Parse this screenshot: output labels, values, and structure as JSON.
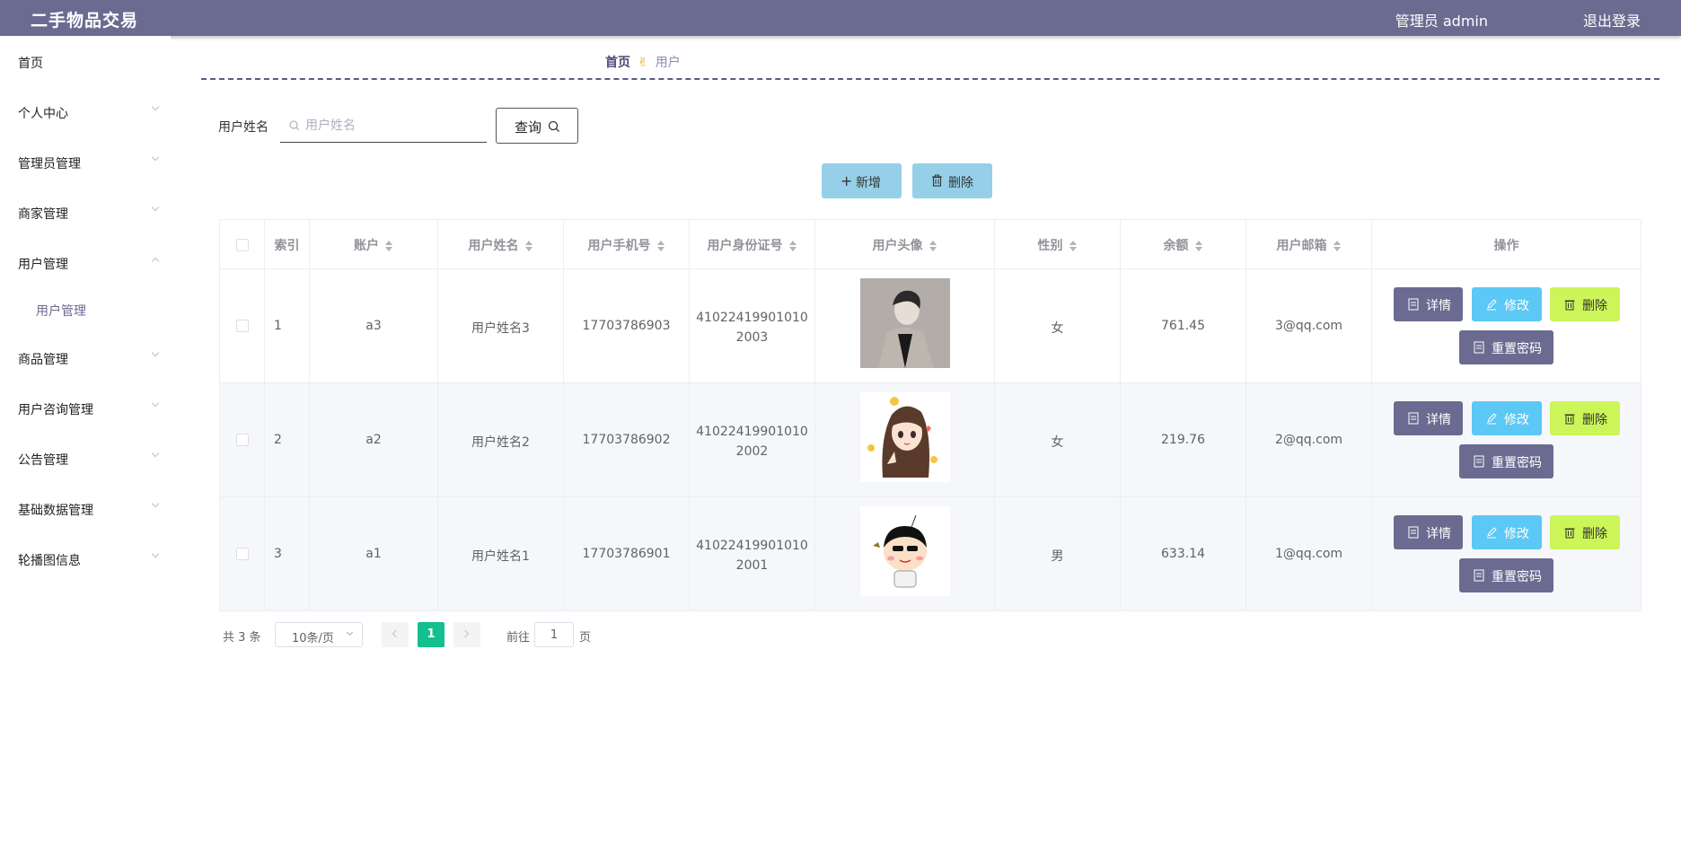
{
  "header": {
    "app_title": "二手物品交易",
    "admin_label": "管理员 admin",
    "logout": "退出登录"
  },
  "sidebar": {
    "items": [
      {
        "label": "首页"
      },
      {
        "label": "个人中心"
      },
      {
        "label": "管理员管理"
      },
      {
        "label": "商家管理"
      },
      {
        "label": "用户管理"
      },
      {
        "label": "商品管理"
      },
      {
        "label": "用户咨询管理"
      },
      {
        "label": "公告管理"
      },
      {
        "label": "基础数据管理"
      },
      {
        "label": "轮播图信息"
      }
    ],
    "submenu": {
      "label": "用户管理"
    }
  },
  "breadcrumb": {
    "home": "首页",
    "separator_icon": "✌",
    "current": "用户"
  },
  "search": {
    "label": "用户姓名",
    "placeholder": "用户姓名",
    "value": "",
    "button": "查询"
  },
  "actions": {
    "add": "新增",
    "delete": "删除"
  },
  "table": {
    "headers": [
      "索引",
      "账户",
      "用户姓名",
      "用户手机号",
      "用户身份证号",
      "用户头像",
      "性别",
      "余额",
      "用户邮箱",
      "操作"
    ],
    "rows": [
      {
        "index": "1",
        "account": "a3",
        "name": "用户姓名3",
        "phone": "17703786903",
        "id_line1": "41022419901010",
        "id_line2": "2003",
        "avatar": "photo-avatar",
        "gender": "女",
        "balance": "761.45",
        "email": "3@qq.com"
      },
      {
        "index": "2",
        "account": "a2",
        "name": "用户姓名2",
        "phone": "17703786902",
        "id_line1": "41022419901010",
        "id_line2": "2002",
        "avatar": "cartoon-girl-avatar",
        "gender": "女",
        "balance": "219.76",
        "email": "2@qq.com"
      },
      {
        "index": "3",
        "account": "a1",
        "name": "用户姓名1",
        "phone": "17703786901",
        "id_line1": "41022419901010",
        "id_line2": "2001",
        "avatar": "cartoon-boy-avatar",
        "gender": "男",
        "balance": "633.14",
        "email": "1@qq.com"
      }
    ],
    "row_actions": {
      "detail": "详情",
      "edit": "修改",
      "delete": "删除",
      "reset": "重置密码"
    }
  },
  "pagination": {
    "total": "共 3 条",
    "page_size": "10条/页",
    "current_page": "1",
    "goto_label": "前往",
    "goto_value": "1",
    "unit": "页"
  },
  "colors": {
    "brand": "#6b6b91",
    "edit": "#5bc8f5",
    "delete": "#ccf55a",
    "primary_page": "#13c08f"
  }
}
